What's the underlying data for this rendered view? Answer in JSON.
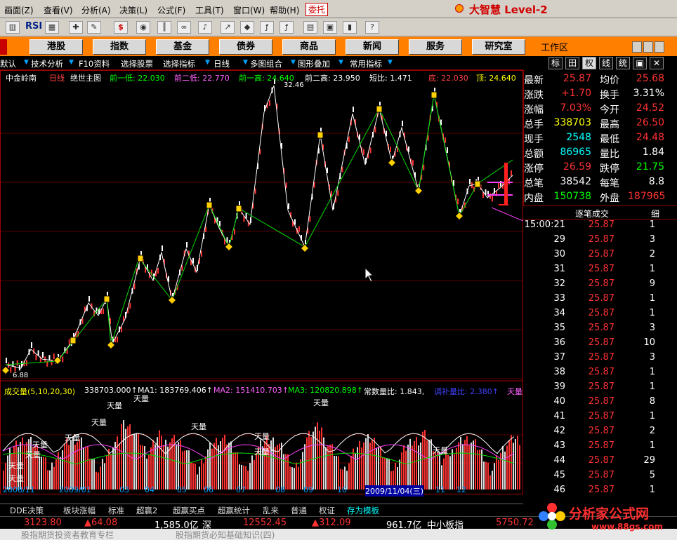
{
  "menu": [
    "画面(Z)",
    "查看(V)",
    "分析(A)",
    "决策(L)",
    "公式(F)",
    "工具(T)",
    "窗口(W)",
    "帮助(H)"
  ],
  "weituo": "委托",
  "brand": "大智慧 Level-2",
  "toolbar_rsi": "RSI",
  "sections": [
    "港股",
    "指数",
    "基金",
    "债券",
    "商品",
    "新闻",
    "服务",
    "研究室"
  ],
  "workarea": "工作区",
  "funcbar": [
    "默认",
    "技术分析",
    "F10资料",
    "选择股票",
    "选择指标",
    "日线",
    "多图组合",
    "图形叠加",
    "常用指标"
  ],
  "right_tabs": [
    "标",
    "田",
    "权",
    "线",
    "统"
  ],
  "chart_header": {
    "name": "中金岭南",
    "period": "日线",
    "system": "绝世主图",
    "low1": "前一低: 22.030",
    "low2": "前二低: 22.770",
    "high1": "前一高: 24.640",
    "high2": "前二高: 23.950",
    "short": "短比: 1.471",
    "bottom": "底: 22.030",
    "top": "顶: 24.640"
  },
  "chart_labels": {
    "peak": "32.46",
    "trough": "6.88",
    "left_ticker": "↑"
  },
  "vol_header": {
    "title": "成交量(5,10,20,30)",
    "value": "338703.000↑",
    "ma1": "MA1: 183769.406↑",
    "ma2": "MA2: 151410.703↑",
    "ma3": "MA3: 120820.898↑",
    "ratio": "常数量比: 1.843,",
    "avg": "调补量比: 2.380↑",
    "sky": "天量"
  },
  "vol_markers": [
    "天量",
    "天量",
    "天量",
    "天量",
    "天量",
    "天量",
    "天量",
    "天量",
    "天量",
    "天量",
    "天量",
    "天量",
    "天量"
  ],
  "x_axis": [
    "2008/11",
    "2009/01",
    "03",
    "04",
    "05",
    "06",
    "07",
    "08",
    "09",
    "10",
    "2009/11/04(三)",
    "11",
    "12"
  ],
  "quote": [
    {
      "l": "最新",
      "v": "25.87",
      "c": "#ff3232",
      "l2": "均价",
      "v2": "25.68",
      "c2": "#ff3232"
    },
    {
      "l": "涨跌",
      "v": "+1.70",
      "c": "#ff3232",
      "l2": "换手",
      "v2": "3.31%",
      "c2": "#ffffff"
    },
    {
      "l": "涨幅",
      "v": "7.03%",
      "c": "#ff3232",
      "l2": "今开",
      "v2": "24.52",
      "c2": "#ff3232"
    },
    {
      "l": "总手",
      "v": "338703",
      "c": "#ffff00",
      "l2": "最高",
      "v2": "26.50",
      "c2": "#ff3232"
    },
    {
      "l": "现手",
      "v": "2548",
      "c": "#00ffff",
      "l2": "最低",
      "v2": "24.48",
      "c2": "#ff3232"
    },
    {
      "l": "总额",
      "v": "86965",
      "c": "#00ffff",
      "l2": "量比",
      "v2": "1.84",
      "c2": "#ffffff"
    },
    {
      "l": "涨停",
      "v": "26.59",
      "c": "#ff3232",
      "l2": "跌停",
      "v2": "21.75",
      "c2": "#00ff00"
    },
    {
      "l": "总笔",
      "v": "38542",
      "c": "#ffffff",
      "l2": "每笔",
      "v2": "8.8",
      "c2": "#ffffff"
    },
    {
      "l": "内盘",
      "v": "150738",
      "c": "#00ff00",
      "l2": "外盘",
      "v2": "187965",
      "c2": "#ff3232"
    }
  ],
  "ticks_header": "逐笔成交",
  "ticks_header_right": "细",
  "ticks": [
    {
      "t": "15:00:21",
      "p": "25.87",
      "v": "1"
    },
    {
      "t": "29",
      "p": "25.87",
      "v": "3"
    },
    {
      "t": "30",
      "p": "25.87",
      "v": "2"
    },
    {
      "t": "31",
      "p": "25.87",
      "v": "1"
    },
    {
      "t": "32",
      "p": "25.87",
      "v": "9"
    },
    {
      "t": "33",
      "p": "25.87",
      "v": "1"
    },
    {
      "t": "34",
      "p": "25.87",
      "v": "1"
    },
    {
      "t": "35",
      "p": "25.87",
      "v": "3"
    },
    {
      "t": "36",
      "p": "25.87",
      "v": "10"
    },
    {
      "t": "37",
      "p": "25.87",
      "v": "3"
    },
    {
      "t": "38",
      "p": "25.87",
      "v": "1"
    },
    {
      "t": "39",
      "p": "25.87",
      "v": "1"
    },
    {
      "t": "40",
      "p": "25.87",
      "v": "8"
    },
    {
      "t": "41",
      "p": "25.87",
      "v": "1"
    },
    {
      "t": "42",
      "p": "25.87",
      "v": "2"
    },
    {
      "t": "43",
      "p": "25.87",
      "v": "1"
    },
    {
      "t": "44",
      "p": "25.87",
      "v": "29"
    },
    {
      "t": "45",
      "p": "25.87",
      "v": "5"
    },
    {
      "t": "46",
      "p": "25.87",
      "v": "1"
    }
  ],
  "bottom_tabs": [
    "DDE决策",
    "板块涨幅",
    "标准",
    "超赢2",
    "超赢买点",
    "超赢统计",
    "乱来",
    "普通",
    "权证",
    "存为模板"
  ],
  "status": {
    "sh": "3123.80",
    "sh_chg": "▲64.08",
    "sh_amt": "1,585.0亿",
    "sz_label": "深",
    "sz": "12552.45",
    "sz_chg": "▲312.09",
    "sz_amt": "961.7亿",
    "zx": "中小板指",
    "zx_v": "5750.72"
  },
  "news": [
    "股指期货投资者教育专栏",
    "股指期货必知基础知识(四)"
  ],
  "watermark": {
    "title": "分析家公式网",
    "url": "www.88gs.com"
  }
}
